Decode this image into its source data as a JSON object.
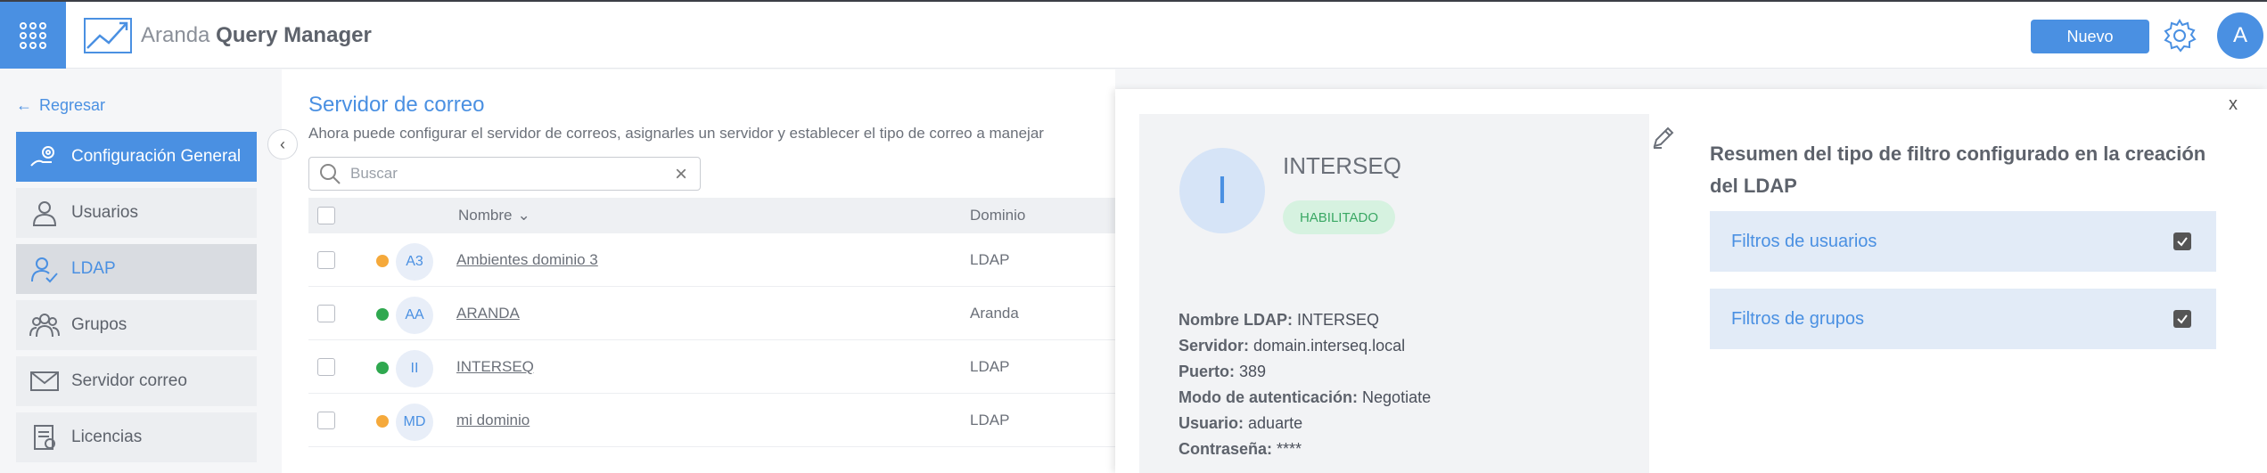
{
  "app": {
    "brand_light": "Aranda",
    "brand_bold": "Query Manager",
    "new_button": "Nuevo",
    "user_initial": "A"
  },
  "sidebar": {
    "back_label": "Regresar",
    "items": [
      {
        "label": "Configuración General",
        "icon": "settings-hand-icon",
        "state": "active"
      },
      {
        "label": "Usuarios",
        "icon": "user-icon",
        "state": "normal"
      },
      {
        "label": "LDAP",
        "icon": "user-check-icon",
        "state": "selected"
      },
      {
        "label": "Grupos",
        "icon": "group-icon",
        "state": "normal"
      },
      {
        "label": "Servidor correo",
        "icon": "mail-icon",
        "state": "normal"
      },
      {
        "label": "Licencias",
        "icon": "license-icon",
        "state": "normal"
      }
    ]
  },
  "main": {
    "title": "Servidor de correo",
    "subtitle": "Ahora puede configurar el servidor de correos, asignarles un servidor y establecer el tipo de correo a manejar",
    "search_placeholder": "Buscar",
    "columns": {
      "name": "Nombre",
      "domain": "Dominio"
    },
    "rows": [
      {
        "initials": "A3",
        "name": "Ambientes dominio 3",
        "domain": "LDAP",
        "status_color": "#f5a93b"
      },
      {
        "initials": "AA",
        "name": "ARANDA",
        "domain": "Aranda",
        "status_color": "#2fa84f"
      },
      {
        "initials": "II",
        "name": "INTERSEQ",
        "domain": "LDAP",
        "status_color": "#2fa84f"
      },
      {
        "initials": "MD",
        "name": "mi dominio",
        "domain": "LDAP",
        "status_color": "#f5a93b"
      }
    ]
  },
  "detail": {
    "close_label": "x",
    "avatar_initial": "I",
    "name": "INTERSEQ",
    "status": "HABILITADO",
    "fields": [
      {
        "key": "Nombre LDAP:",
        "value": "INTERSEQ"
      },
      {
        "key": "Servidor:",
        "value": "domain.interseq.local"
      },
      {
        "key": "Puerto:",
        "value": "389"
      },
      {
        "key": "Modo de autenticación:",
        "value": "Negotiate"
      },
      {
        "key": "Usuario:",
        "value": "aduarte"
      },
      {
        "key": "Contraseña:",
        "value": "****"
      }
    ],
    "summary_title": "Resumen del tipo de filtro configurado en la creación del LDAP",
    "filters": [
      {
        "label": "Filtros de usuarios",
        "checked": true
      },
      {
        "label": "Filtros de grupos",
        "checked": true
      }
    ]
  },
  "colors": {
    "accent": "#4a90e2",
    "enabled_bg": "#d6f2e0",
    "enabled_text": "#3aa864"
  }
}
